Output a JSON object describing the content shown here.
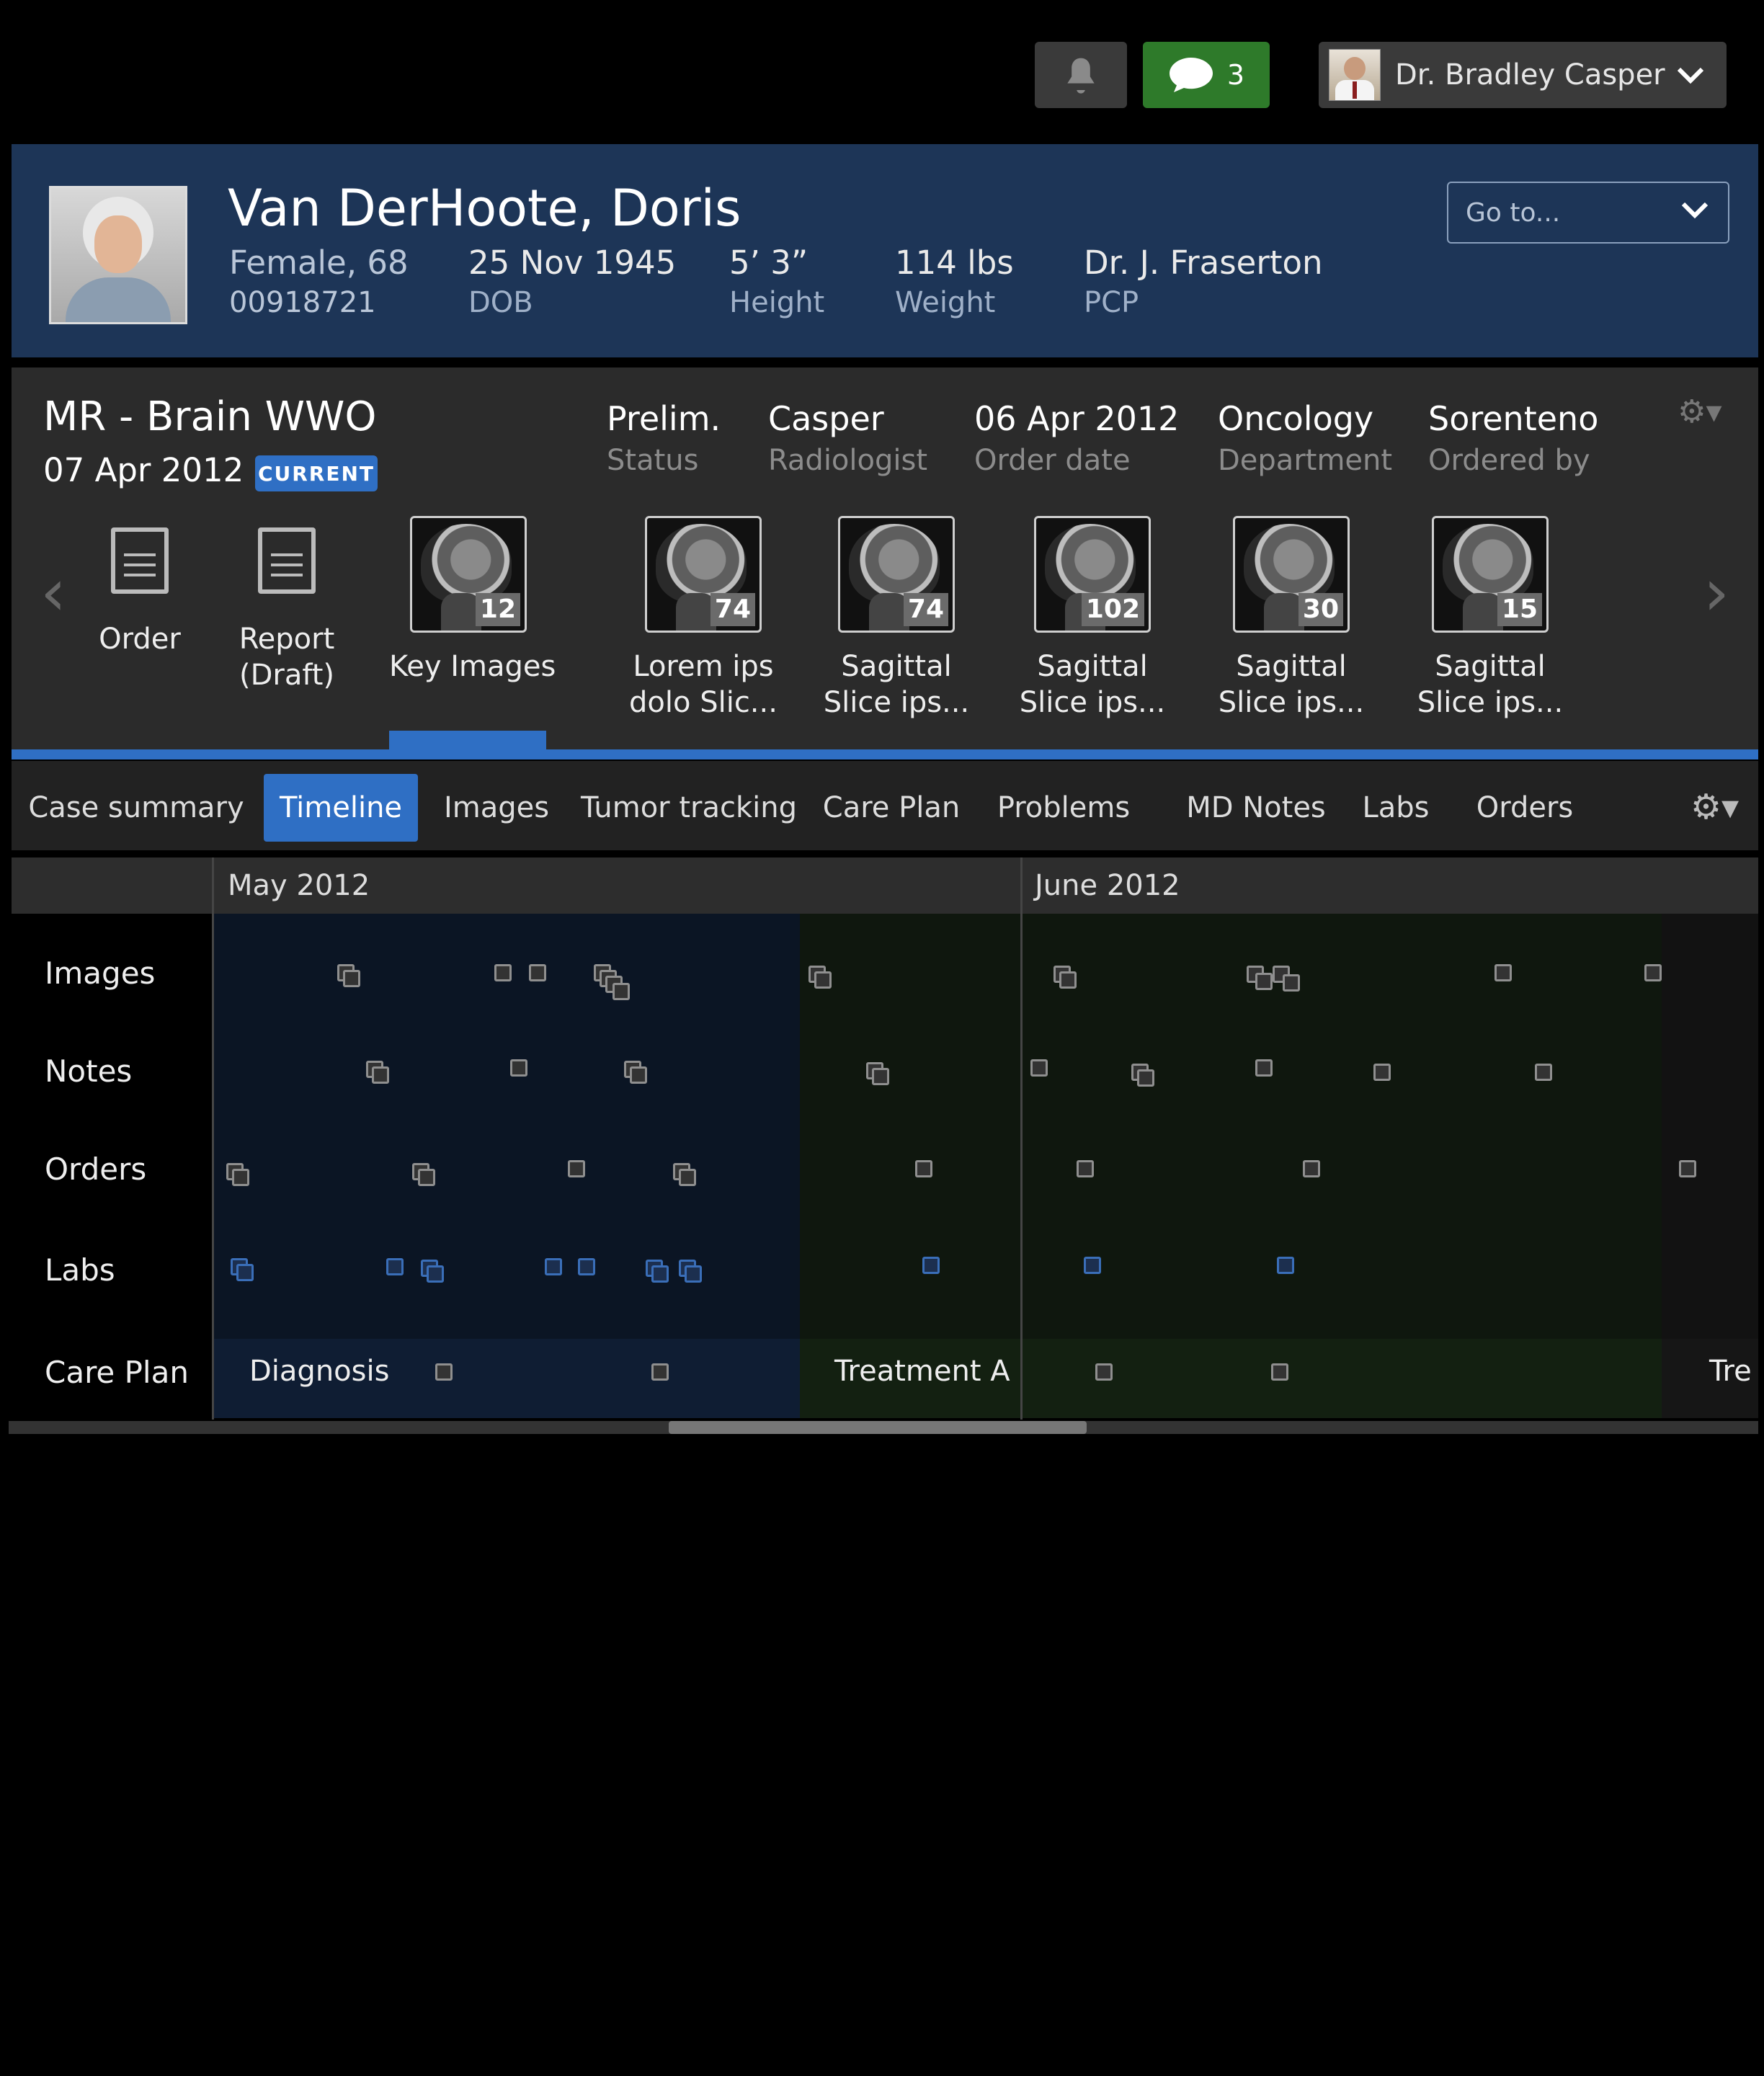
{
  "topbar": {
    "notification_icon": "bell-icon",
    "messages_icon": "speech-bubble-icon",
    "messages_count": "3",
    "user_name": "Dr. Bradley Casper",
    "user_menu_icon": "chevron-down-icon"
  },
  "patient": {
    "name": "Van DerHoote, Doris",
    "sex_age": "Female, 68",
    "mrn": "00918721",
    "dob": "25 Nov 1945",
    "dob_label": "DOB",
    "height": "5’ 3”",
    "height_label": "Height",
    "weight": "114 lbs",
    "weight_label": "Weight",
    "pcp": "Dr. J. Fraserton",
    "pcp_label": "PCP",
    "goto_placeholder": "Go to..."
  },
  "study": {
    "title": "MR - Brain WWO",
    "date": "07 Apr 2012",
    "badge": "CURRENT",
    "fields": [
      {
        "value": "Prelim.",
        "label": "Status"
      },
      {
        "value": "Casper",
        "label": "Radiologist"
      },
      {
        "value": "06 Apr 2012",
        "label": "Order date"
      },
      {
        "value": "Oncology",
        "label": "Department"
      },
      {
        "value": "Sorenteno",
        "label": "Ordered by"
      }
    ],
    "items": [
      {
        "label": "Order"
      },
      {
        "label": "Report",
        "label2": "(Draft)"
      },
      {
        "label": "Key Images",
        "count": "12"
      },
      {
        "label": "Lorem ips",
        "label2": "dolo Slic...",
        "count": "74"
      },
      {
        "label": "Sagittal",
        "label2": "Slice ips...",
        "count": "74"
      },
      {
        "label": "Sagittal",
        "label2": "Slice ips...",
        "count": "102"
      },
      {
        "label": "Sagittal",
        "label2": "Slice ips...",
        "count": "30"
      },
      {
        "label": "Sagittal",
        "label2": "Slice ips...",
        "count": "15"
      }
    ]
  },
  "tabs": [
    {
      "label": "Case summary"
    },
    {
      "label": "Timeline",
      "active": true
    },
    {
      "label": "Images"
    },
    {
      "label": "Tumor tracking"
    },
    {
      "label": "Care Plan"
    },
    {
      "label": "Problems"
    },
    {
      "label": "MD Notes"
    },
    {
      "label": "Labs"
    },
    {
      "label": "Orders"
    }
  ],
  "timeline": {
    "months": [
      "May 2012",
      "June 2012"
    ],
    "rows": [
      "Images",
      "Notes",
      "Orders",
      "Labs",
      "Care Plan"
    ],
    "phases": [
      "Diagnosis",
      "Treatment A",
      "Tre"
    ],
    "colors": {
      "diagnosis_bg": "#0b1524",
      "treatment_bg": "#0f170e",
      "accent": "#2f6fc4"
    }
  }
}
